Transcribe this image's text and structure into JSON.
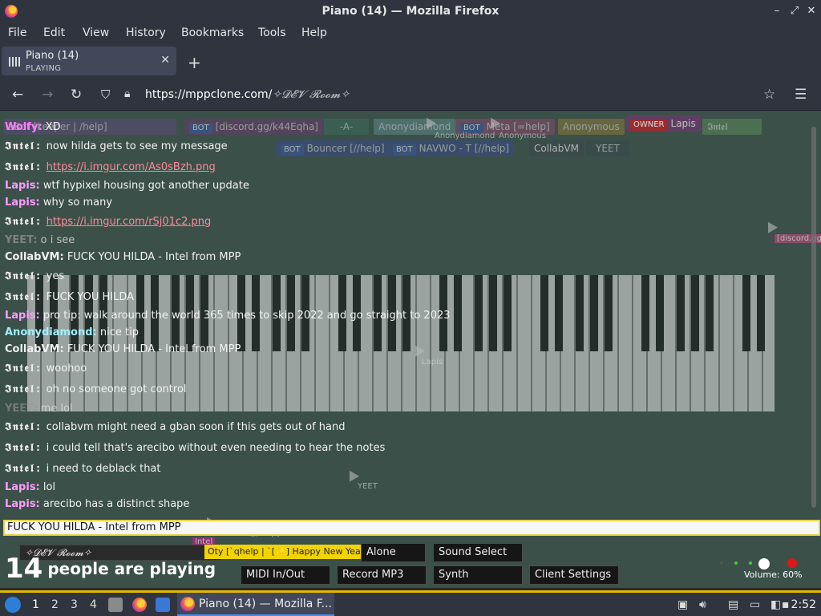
{
  "window": {
    "title": "Piano (14) — Mozilla Firefox"
  },
  "menu": [
    "File",
    "Edit",
    "View",
    "History",
    "Bookmarks",
    "Tools",
    "Help"
  ],
  "tab": {
    "title": "Piano (14)",
    "subtitle": "PLAYING"
  },
  "address": {
    "host": "https://mppclone.com/",
    "room": "✧𝓓𝓔𝓥 𝓡𝓸𝓸𝓶✧"
  },
  "nametags": {
    "row1": [
      {
        "label": "Wolfy: XD",
        "color": "#5a4a7a"
      },
      {
        "label": "aBot [keeper | /help]",
        "color": "#4a6a5a"
      },
      {
        "bot": "BOT",
        "label": "[discord.gg/k44Eqha]",
        "color": "#6a3a6a"
      },
      {
        "label": "-A-",
        "color": "#3a6a5a"
      },
      {
        "label": "Anonydiamond",
        "color": "#5a8a8a"
      },
      {
        "bot": "BOT",
        "label": "Meta [=help]",
        "color": "#8a4a6a"
      },
      {
        "label": "Anonymous",
        "color": "#8a7a3a"
      },
      {
        "owner": "OWNER",
        "label": "Lapis",
        "color": "#6a3a6a"
      },
      {
        "label": "𝕴𝖓𝖙𝖊𝖑",
        "color": "#5a8a5a"
      }
    ],
    "row2": [
      {
        "bot": "BOT",
        "label": "Bouncer [//help]",
        "color": "#3a4a8a"
      },
      {
        "bot": "BOT",
        "label": "NAVWO - T [//help]",
        "color": "#3a4a8a"
      },
      {
        "label": "CollabVM",
        "color": "#3a4a4a"
      },
      {
        "label": "YEET",
        "color": "#3a4a4a"
      }
    ]
  },
  "chat": [
    {
      "nick": "Wolfy:",
      "kind": "wolfy",
      "text": "XD"
    },
    {
      "nick": "𝕴𝖓𝖙𝖊𝖑:",
      "kind": "intel",
      "text": "now hilda gets to see my message"
    },
    {
      "nick": "𝕴𝖓𝖙𝖊𝖑:",
      "kind": "intel",
      "text": "https://i.imgur.com/As0sBzh.png",
      "link": true
    },
    {
      "nick": "Lapis:",
      "kind": "lapis",
      "text": "wtf hypixel housing got another update"
    },
    {
      "nick": "Lapis:",
      "kind": "lapis",
      "text": "why so many"
    },
    {
      "nick": "𝕴𝖓𝖙𝖊𝖑:",
      "kind": "intel",
      "text": "https://i.imgur.com/rSj01c2.png",
      "link": true
    },
    {
      "nick": "YEET:",
      "kind": "yeet",
      "text": "o i see"
    },
    {
      "nick": "CollabVM:",
      "kind": "collab",
      "text": "FUCK YOU HILDA - Intel from MPP"
    },
    {
      "nick": "𝕴𝖓𝖙𝖊𝖑:",
      "kind": "intel",
      "text": "yes"
    },
    {
      "nick": "𝕴𝖓𝖙𝖊𝖑:",
      "kind": "intel",
      "text": "FUCK YOU HILDA"
    },
    {
      "nick": "Lapis:",
      "kind": "lapis",
      "text": "pro tip: walk around the world 365 times to skip 2022 and go straight to 2023"
    },
    {
      "nick": "Anonydiamond:",
      "kind": "anony",
      "text": "nice tip"
    },
    {
      "nick": "CollabVM:",
      "kind": "collab",
      "text": "FUCK YOU HILDA - Intel from MPP"
    },
    {
      "nick": "𝕴𝖓𝖙𝖊𝖑:",
      "kind": "intel",
      "text": "woohoo"
    },
    {
      "nick": "𝕴𝖓𝖙𝖊𝖑:",
      "kind": "intel",
      "text": "oh no someone got control"
    },
    {
      "nick": "YEET:",
      "kind": "yeet",
      "text": "me lol"
    },
    {
      "nick": "𝕴𝖓𝖙𝖊𝖑:",
      "kind": "intel",
      "text": "collabvm might need a gban soon if this gets out of hand"
    },
    {
      "nick": "𝕴𝖓𝖙𝖊𝖑:",
      "kind": "intel",
      "text": "i could tell that's arecibo without even needing to hear the notes"
    },
    {
      "nick": "𝕴𝖓𝖙𝖊𝖑:",
      "kind": "intel",
      "text": "i need to deblack that"
    },
    {
      "nick": "Lapis:",
      "kind": "lapis",
      "text": "lol"
    },
    {
      "nick": "Lapis:",
      "kind": "lapis",
      "text": "arecibo has a distinct shape"
    }
  ],
  "cursors": [
    {
      "label": "Anonydiamond"
    },
    {
      "label": "Anonymous"
    },
    {
      "label": "Lapis"
    },
    {
      "label": "YEET"
    },
    {
      "label": "[discord.gg..."
    },
    {
      "label": "Bouncer [//help]"
    },
    {
      "label": "Intel"
    }
  ],
  "input": {
    "value": "FUCK YOU HILDA - Intel from MPP"
  },
  "room_select": "✧𝓓𝓔𝓥 𝓡𝓸𝓸𝓶✧",
  "notification": "Oty [`qhelp | `[✨] Happy New Year]",
  "play_count": {
    "number": "14",
    "label": "people are playing"
  },
  "buttons": {
    "play_alone": "Alone",
    "sound_select": "Sound Select",
    "midi": "MIDI In/Out",
    "record": "Record MP3",
    "synth": "Synth",
    "client_settings": "Client Settings"
  },
  "volume": {
    "label": "Volume: 60%",
    "level": 0.6
  },
  "taskbar": {
    "workspaces": [
      "1",
      "2",
      "3",
      "4"
    ],
    "window_label": "Piano (14) — Mozilla F...",
    "clock": "2:52"
  },
  "colors": {
    "accent": "#e5b900",
    "chat_bg": "#3b5049",
    "link": "#ff8a9c"
  },
  "icons": [
    "firefox-icon",
    "back-icon",
    "forward-icon",
    "reload-icon",
    "shield-icon",
    "lock-icon",
    "star-icon",
    "hamburger-menu-icon",
    "piano-icon",
    "close-icon"
  ]
}
